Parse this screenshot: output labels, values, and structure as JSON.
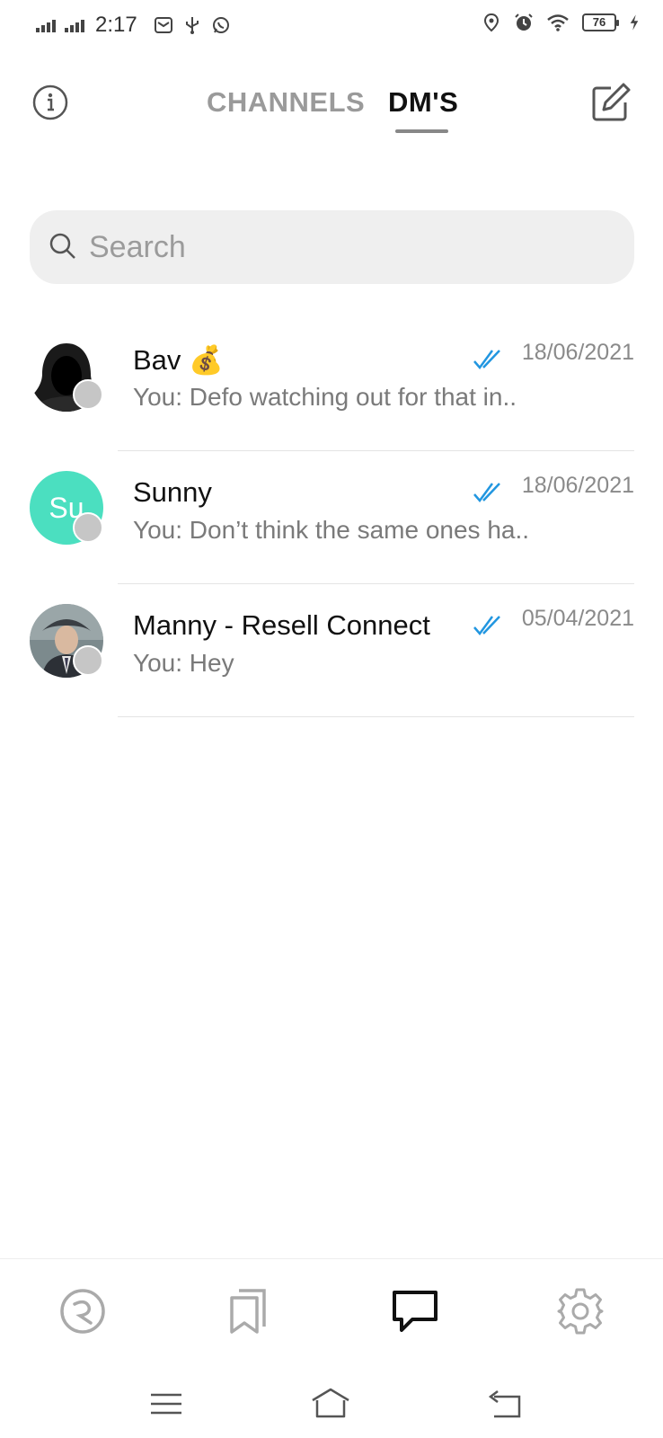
{
  "status_bar": {
    "time": "2:17",
    "battery_level": "76",
    "left_icons": [
      "signal-icon",
      "signal-icon",
      "email-icon",
      "usb-icon",
      "whatsapp-icon"
    ],
    "right_icons": [
      "location-icon",
      "alarm-icon",
      "wifi-icon",
      "battery-icon",
      "charging-icon"
    ]
  },
  "header": {
    "tabs": [
      {
        "label": "CHANNELS",
        "active": false
      },
      {
        "label": "DM'S",
        "active": true
      }
    ]
  },
  "search": {
    "placeholder": "Search",
    "value": ""
  },
  "conversations": [
    {
      "name": "Bav 💰",
      "preview": "You: Defo watching out for that in..",
      "date": "18/06/2021",
      "avatar_type": "photo",
      "read": true
    },
    {
      "name": "Sunny",
      "preview": "You: Don’t think the same ones ha..",
      "date": "18/06/2021",
      "avatar_type": "initials",
      "initials": "Su",
      "avatar_color": "#4bdfc0",
      "read": true
    },
    {
      "name": "Manny - Resell Connect",
      "preview": "You: Hey",
      "date": "05/04/2021",
      "avatar_type": "photo",
      "read": true
    }
  ],
  "bottom_nav": {
    "items": [
      {
        "icon": "logo-icon",
        "active": false
      },
      {
        "icon": "bookmarks-icon",
        "active": false
      },
      {
        "icon": "chat-icon",
        "active": true
      },
      {
        "icon": "settings-icon",
        "active": false
      }
    ]
  },
  "system_nav": [
    "menu-icon",
    "home-icon",
    "back-icon"
  ],
  "colors": {
    "accent_check": "#2196e0",
    "active_tab": "#111111",
    "inactive_tab": "#9a9a9a",
    "initials_avatar": "#4bdfc0",
    "presence_dot": "#c6c6c6"
  }
}
